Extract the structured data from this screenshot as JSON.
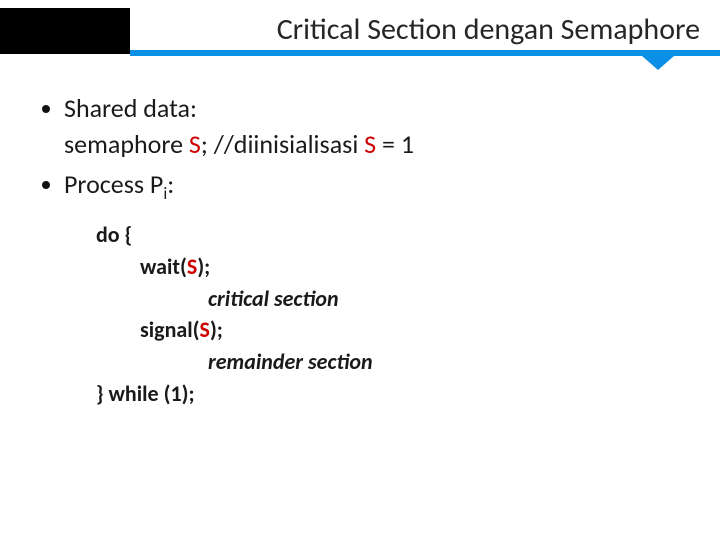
{
  "title": "Critical Section dengan Semaphore",
  "bullets": {
    "b1_label": "Shared data:",
    "b1_line2_pre": "semaphore ",
    "b1_line2_var": "S",
    "b1_line2_mid": "; //diinisialisasi ",
    "b1_line2_var2": "S",
    "b1_line2_post": " = 1",
    "b2_pre": "Process P",
    "b2_sub": "i",
    "b2_post": ":"
  },
  "code": {
    "l1": "do {",
    "l2_pre": "wait(",
    "l2_var": "S",
    "l2_post": ");",
    "l3": "critical section",
    "l4_pre": "signal(",
    "l4_var": "S",
    "l4_post": ");",
    "l5": "remainder section",
    "l6": "} while (1);"
  }
}
